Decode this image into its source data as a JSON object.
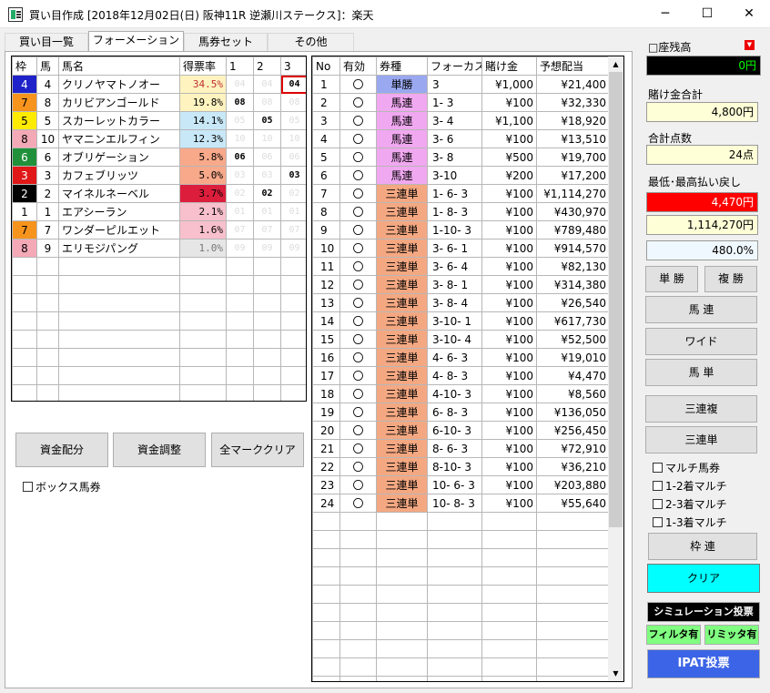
{
  "window": {
    "title": "買い目作成 [2018年12月02日(日) 阪神11R 逆瀬川ステークス]：楽天",
    "minimize": "─",
    "maximize": "☐",
    "close": "✕"
  },
  "tabs": [
    "買い目一覧",
    "フォーメーション",
    "馬券セット",
    "その他"
  ],
  "horse_grid": {
    "headers": [
      "枠",
      "馬",
      "馬名",
      "得票率",
      "1",
      "2",
      "3"
    ],
    "rows": [
      {
        "waku": "4",
        "uma": "4",
        "name": "クリノヤマトノオー",
        "rate": "34.5%",
        "p1": "04",
        "p2": "04",
        "p3": "04",
        "wakucolor": "#1e22c8",
        "wakutext": "#fff",
        "ratebg": "#fff3c0",
        "ratecolor": "#c03030",
        "s1": false,
        "s2": false,
        "s3": true,
        "r3": true
      },
      {
        "waku": "7",
        "uma": "8",
        "name": "カリビアンゴールド",
        "rate": "19.8%",
        "p1": "08",
        "p2": "08",
        "p3": "08",
        "wakucolor": "#f7941d",
        "wakutext": "#000",
        "ratebg": "#fff3c0",
        "ratecolor": "#000",
        "s1": true,
        "s2": false,
        "s3": false,
        "r3": false
      },
      {
        "waku": "5",
        "uma": "5",
        "name": "スカーレットカラー",
        "rate": "14.1%",
        "p1": "05",
        "p2": "05",
        "p3": "05",
        "wakucolor": "#ffeb00",
        "wakutext": "#000",
        "ratebg": "#c8e8f8",
        "ratecolor": "#000",
        "s1": false,
        "s2": true,
        "s3": false,
        "r3": false
      },
      {
        "waku": "8",
        "uma": "10",
        "name": "ヤマニンエルフィン",
        "rate": "12.3%",
        "p1": "10",
        "p2": "10",
        "p3": "10",
        "wakucolor": "#f4a9b7",
        "wakutext": "#000",
        "ratebg": "#c8e8f8",
        "ratecolor": "#000",
        "s1": false,
        "s2": false,
        "s3": false,
        "r3": false
      },
      {
        "waku": "6",
        "uma": "6",
        "name": "オブリゲーション",
        "rate": "5.8%",
        "p1": "06",
        "p2": "06",
        "p3": "06",
        "wakucolor": "#21903a",
        "wakutext": "#fff",
        "ratebg": "#f8a98a",
        "ratecolor": "#000",
        "s1": true,
        "s2": false,
        "s3": false,
        "r3": false
      },
      {
        "waku": "3",
        "uma": "3",
        "name": "カフェブリッツ",
        "rate": "5.0%",
        "p1": "03",
        "p2": "03",
        "p3": "03",
        "wakucolor": "#e01818",
        "wakutext": "#fff",
        "ratebg": "#f8a98a",
        "ratecolor": "#000",
        "s1": false,
        "s2": false,
        "s3": true,
        "r3": false
      },
      {
        "waku": "2",
        "uma": "2",
        "name": "マイネルネーベル",
        "rate": "3.7%",
        "p1": "02",
        "p2": "02",
        "p3": "02",
        "wakucolor": "#000000",
        "wakutext": "#fff",
        "ratebg": "#dc1e3c",
        "ratecolor": "#000",
        "s1": false,
        "s2": true,
        "s3": false,
        "r3": false
      },
      {
        "waku": "1",
        "uma": "1",
        "name": "エアシーラン",
        "rate": "2.1%",
        "p1": "01",
        "p2": "01",
        "p3": "01",
        "wakucolor": "#ffffff",
        "wakutext": "#000",
        "ratebg": "#f8c0cc",
        "ratecolor": "#000",
        "s1": false,
        "s2": false,
        "s3": false,
        "r3": false
      },
      {
        "waku": "7",
        "uma": "7",
        "name": "ワンダーピルエット",
        "rate": "1.6%",
        "p1": "07",
        "p2": "07",
        "p3": "07",
        "wakucolor": "#f7941d",
        "wakutext": "#000",
        "ratebg": "#f8c0cc",
        "ratecolor": "#000",
        "s1": false,
        "s2": false,
        "s3": false,
        "r3": false
      },
      {
        "waku": "8",
        "uma": "9",
        "name": "エリモジパング",
        "rate": "1.0%",
        "p1": "09",
        "p2": "09",
        "p3": "09",
        "wakucolor": "#f4a9b7",
        "wakutext": "#000",
        "ratebg": "#e6e6e6",
        "ratecolor": "#777",
        "s1": false,
        "s2": false,
        "s3": false,
        "r3": false
      }
    ]
  },
  "buttons": {
    "allocate": "資金配分",
    "adjust": "資金調整",
    "clear_marks": "全マーククリア"
  },
  "box_bet": "ボックス馬券",
  "bet_grid": {
    "headers": [
      "No",
      "有効",
      "券種",
      "フォーカス",
      "賭け金",
      "予想配当"
    ],
    "rows": [
      {
        "no": "1",
        "valid": "〇",
        "type": "単勝",
        "focus": "3",
        "bet": "¥1,000",
        "payout": "¥21,400",
        "bg": "#9aa8f0"
      },
      {
        "no": "2",
        "valid": "〇",
        "type": "馬連",
        "focus": "1- 3",
        "bet": "¥100",
        "payout": "¥32,330",
        "bg": "#f0a8f0"
      },
      {
        "no": "3",
        "valid": "〇",
        "type": "馬連",
        "focus": "3- 4",
        "bet": "¥1,100",
        "payout": "¥18,920",
        "bg": "#f0a8f0"
      },
      {
        "no": "4",
        "valid": "〇",
        "type": "馬連",
        "focus": "3- 6",
        "bet": "¥100",
        "payout": "¥13,510",
        "bg": "#f0a8f0"
      },
      {
        "no": "5",
        "valid": "〇",
        "type": "馬連",
        "focus": "3- 8",
        "bet": "¥500",
        "payout": "¥19,700",
        "bg": "#f0a8f0"
      },
      {
        "no": "6",
        "valid": "〇",
        "type": "馬連",
        "focus": "3-10",
        "bet": "¥200",
        "payout": "¥17,200",
        "bg": "#f0a8f0"
      },
      {
        "no": "7",
        "valid": "〇",
        "type": "三連単",
        "focus": "1- 6- 3",
        "bet": "¥100",
        "payout": "¥1,114,270",
        "bg": "#f4a882"
      },
      {
        "no": "8",
        "valid": "〇",
        "type": "三連単",
        "focus": "1- 8- 3",
        "bet": "¥100",
        "payout": "¥430,970",
        "bg": "#f4a882"
      },
      {
        "no": "9",
        "valid": "〇",
        "type": "三連単",
        "focus": "1-10- 3",
        "bet": "¥100",
        "payout": "¥789,480",
        "bg": "#f4a882"
      },
      {
        "no": "10",
        "valid": "〇",
        "type": "三連単",
        "focus": "3- 6- 1",
        "bet": "¥100",
        "payout": "¥914,570",
        "bg": "#f4a882"
      },
      {
        "no": "11",
        "valid": "〇",
        "type": "三連単",
        "focus": "3- 6- 4",
        "bet": "¥100",
        "payout": "¥82,130",
        "bg": "#f4a882"
      },
      {
        "no": "12",
        "valid": "〇",
        "type": "三連単",
        "focus": "3- 8- 1",
        "bet": "¥100",
        "payout": "¥314,380",
        "bg": "#f4a882"
      },
      {
        "no": "13",
        "valid": "〇",
        "type": "三連単",
        "focus": "3- 8- 4",
        "bet": "¥100",
        "payout": "¥26,540",
        "bg": "#f4a882"
      },
      {
        "no": "14",
        "valid": "〇",
        "type": "三連単",
        "focus": "3-10- 1",
        "bet": "¥100",
        "payout": "¥617,730",
        "bg": "#f4a882"
      },
      {
        "no": "15",
        "valid": "〇",
        "type": "三連単",
        "focus": "3-10- 4",
        "bet": "¥100",
        "payout": "¥52,500",
        "bg": "#f4a882"
      },
      {
        "no": "16",
        "valid": "〇",
        "type": "三連単",
        "focus": "4- 6- 3",
        "bet": "¥100",
        "payout": "¥19,010",
        "bg": "#f4a882"
      },
      {
        "no": "17",
        "valid": "〇",
        "type": "三連単",
        "focus": "4- 8- 3",
        "bet": "¥100",
        "payout": "¥4,470",
        "bg": "#f4a882"
      },
      {
        "no": "18",
        "valid": "〇",
        "type": "三連単",
        "focus": "4-10- 3",
        "bet": "¥100",
        "payout": "¥8,560",
        "bg": "#f4a882"
      },
      {
        "no": "19",
        "valid": "〇",
        "type": "三連単",
        "focus": "6- 8- 3",
        "bet": "¥100",
        "payout": "¥136,050",
        "bg": "#f4a882"
      },
      {
        "no": "20",
        "valid": "〇",
        "type": "三連単",
        "focus": "6-10- 3",
        "bet": "¥100",
        "payout": "¥256,450",
        "bg": "#f4a882"
      },
      {
        "no": "21",
        "valid": "〇",
        "type": "三連単",
        "focus": "8- 6- 3",
        "bet": "¥100",
        "payout": "¥72,910",
        "bg": "#f4a882"
      },
      {
        "no": "22",
        "valid": "〇",
        "type": "三連単",
        "focus": "8-10- 3",
        "bet": "¥100",
        "payout": "¥36,210",
        "bg": "#f4a882"
      },
      {
        "no": "23",
        "valid": "〇",
        "type": "三連単",
        "focus": "10- 6- 3",
        "bet": "¥100",
        "payout": "¥203,880",
        "bg": "#f4a882"
      },
      {
        "no": "24",
        "valid": "〇",
        "type": "三連単",
        "focus": "10- 8- 3",
        "bet": "¥100",
        "payout": "¥55,640",
        "bg": "#f4a882"
      }
    ]
  },
  "right": {
    "balance_label": "□座残高",
    "balance": "0円",
    "total_bet_label": "賭け金合計",
    "total_bet": "4,800円",
    "total_points_label": "合計点数",
    "total_points": "24点",
    "minmax_label": "最低･最高払い戻し",
    "min_payout": "4,470円",
    "max_payout": "1,114,270円",
    "ratio": "480.0%",
    "tansho": "単 勝",
    "fukusho": "複 勝",
    "umaren": "馬 連",
    "wide": "ワイド",
    "umatan": "馬 単",
    "sanrenpuku": "三連複",
    "sanrentan": "三連単",
    "multi": "マルチ馬券",
    "multi12": "1-2着マルチ",
    "multi23": "2-3着マルチ",
    "multi13": "1-3着マルチ",
    "wakuren": "枠 連",
    "clear": "クリア",
    "simulation": "シミュレーション投票",
    "filter": "フィルタ有",
    "limit": "リミッタ有",
    "ipat": "IPAT投票"
  }
}
